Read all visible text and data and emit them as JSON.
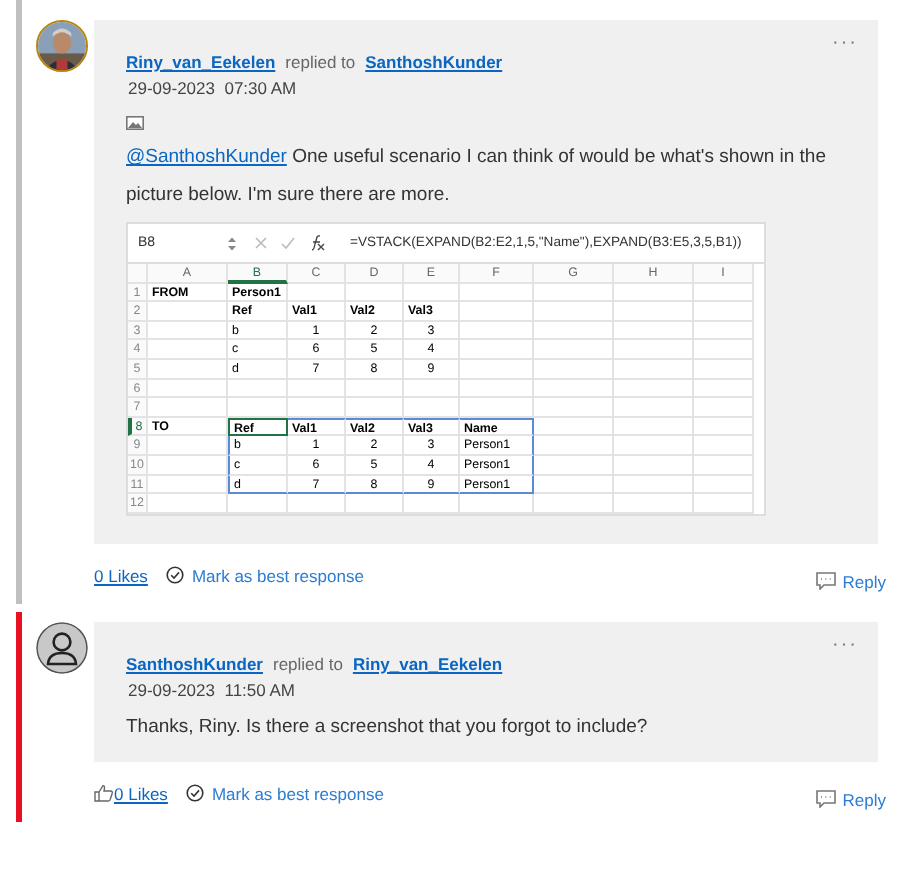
{
  "posts": [
    {
      "color": "#c0c0c0",
      "author": "Riny_van_Eekelen",
      "replied_label": "replied to",
      "recipient": "SanthoshKunder",
      "date": "29-09-2023",
      "time": "07:30 AM",
      "has_image_icon": true,
      "mention": "@SanthoshKunder",
      "text": "One useful scenario I can think of would be what's shown in the picture below. I'm sure there are more.",
      "spreadsheet": {
        "name_box": "B8",
        "formula": "=VSTACK(EXPAND(B2:E2,1,5,\"Name\"),EXPAND(B3:E5,3,5,B1))",
        "columns": [
          {
            "label": "A",
            "selected": false,
            "in_range": false
          },
          {
            "label": "B",
            "selected": true,
            "in_range": true
          },
          {
            "label": "C",
            "selected": false,
            "in_range": true
          },
          {
            "label": "D",
            "selected": false,
            "in_range": true
          },
          {
            "label": "E",
            "selected": false,
            "in_range": true
          },
          {
            "label": "F",
            "selected": false,
            "in_range": true
          },
          {
            "label": "G",
            "selected": false,
            "in_range": false
          },
          {
            "label": "H",
            "selected": false,
            "in_range": false
          },
          {
            "label": "I",
            "selected": false,
            "in_range": false
          }
        ],
        "rows": [
          {
            "label": "1",
            "selected": false,
            "in_range": false,
            "cells": [
              "FROM",
              "Person1",
              "",
              "",
              "",
              "",
              "",
              "",
              ""
            ]
          },
          {
            "label": "2",
            "selected": false,
            "in_range": false,
            "cells": [
              "",
              "Ref",
              "Val1",
              "Val2",
              "Val3",
              "",
              "",
              "",
              ""
            ]
          },
          {
            "label": "3",
            "selected": false,
            "in_range": false,
            "cells": [
              "",
              "b",
              "1",
              "2",
              "3",
              "",
              "",
              "",
              ""
            ]
          },
          {
            "label": "4",
            "selected": false,
            "in_range": false,
            "cells": [
              "",
              "c",
              "6",
              "5",
              "4",
              "",
              "",
              "",
              ""
            ]
          },
          {
            "label": "5",
            "selected": false,
            "in_range": false,
            "cells": [
              "",
              "d",
              "7",
              "8",
              "9",
              "",
              "",
              "",
              ""
            ]
          },
          {
            "label": "6",
            "selected": false,
            "in_range": false,
            "cells": [
              "",
              "",
              "",
              "",
              "",
              "",
              "",
              "",
              ""
            ]
          },
          {
            "label": "7",
            "selected": false,
            "in_range": false,
            "cells": [
              "",
              "",
              "",
              "",
              "",
              "",
              "",
              "",
              ""
            ]
          },
          {
            "label": "8",
            "selected": true,
            "in_range": true,
            "cells": [
              "TO",
              "Ref",
              "Val1",
              "Val2",
              "Val3",
              "Name",
              "",
              "",
              ""
            ]
          },
          {
            "label": "9",
            "selected": false,
            "in_range": true,
            "cells": [
              "",
              "b",
              "1",
              "2",
              "3",
              "Person1",
              "",
              "",
              ""
            ]
          },
          {
            "label": "10",
            "selected": false,
            "in_range": true,
            "cells": [
              "",
              "c",
              "6",
              "5",
              "4",
              "Person1",
              "",
              "",
              ""
            ]
          },
          {
            "label": "11",
            "selected": false,
            "in_range": true,
            "cells": [
              "",
              "d",
              "7",
              "8",
              "9",
              "Person1",
              "",
              "",
              ""
            ]
          },
          {
            "label": "12",
            "selected": false,
            "in_range": false,
            "cells": [
              "",
              "",
              "",
              "",
              "",
              "",
              "",
              "",
              ""
            ]
          }
        ]
      },
      "like_icon": false,
      "likes": "0 Likes",
      "best_response": "Mark as best response",
      "reply": "Reply",
      "menu": "···"
    },
    {
      "color": "#e81123",
      "avatar": {
        "kind": "silhouette"
      },
      "author": "SanthoshKunder",
      "replied_label": "replied to",
      "recipient": "Riny_van_Eekelen",
      "date": "29-09-2023",
      "time": "11:50 AM",
      "has_image_icon": false,
      "text": "Thanks, Riny. Is there a screenshot that you forgot to include?",
      "like_icon": true,
      "likes": "0 Likes",
      "best_response": "Mark as best response",
      "reply": "Reply",
      "menu": "···"
    }
  ]
}
